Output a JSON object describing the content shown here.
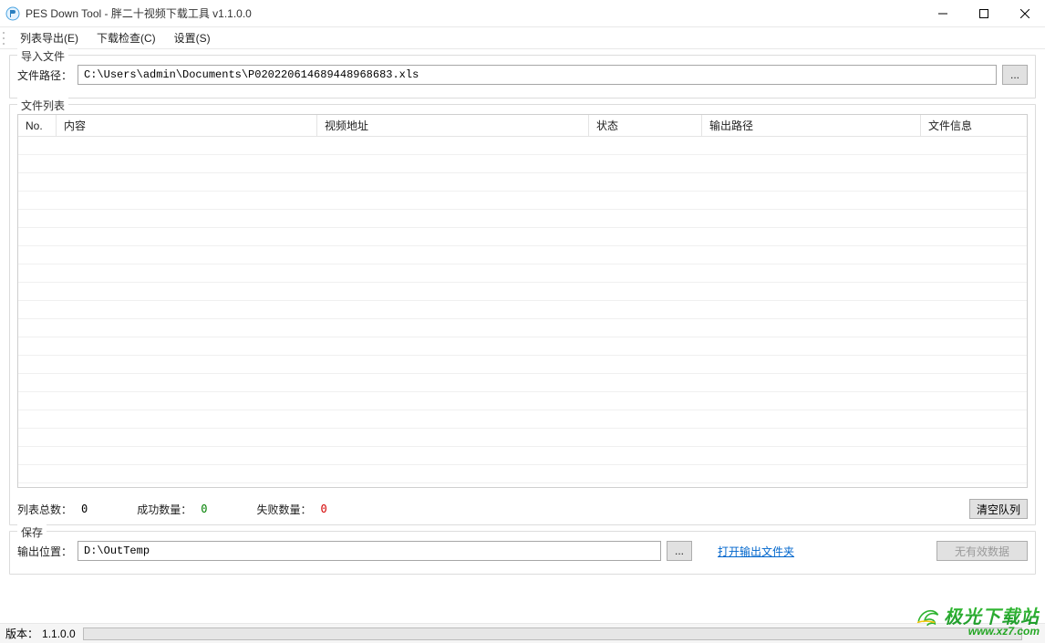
{
  "window": {
    "title": "PES Down Tool - 胖二十视频下载工具 v1.1.0.0"
  },
  "menu": {
    "export": "列表导出(E)",
    "check": "下载检查(C)",
    "settings": "设置(S)"
  },
  "import_group": {
    "title": "导入文件",
    "path_label": "文件路径：",
    "path_value": "C:\\Users\\admin\\Documents\\P020220614689448968683.xls",
    "browse_label": "..."
  },
  "filelist_group": {
    "title": "文件列表",
    "columns": {
      "no": "No.",
      "content": "内容",
      "video_url": "视频地址",
      "status": "状态",
      "output_path": "输出路径",
      "file_info": "文件信息"
    },
    "rows": []
  },
  "stats": {
    "total_label": "列表总数：",
    "total_value": "0",
    "success_label": "成功数量：",
    "success_value": "0",
    "fail_label": "失败数量：",
    "fail_value": "0",
    "clear_label": "清空队列"
  },
  "save_group": {
    "title": "保存",
    "output_label": "输出位置：",
    "output_value": "D:\\OutTemp",
    "browse_label": "...",
    "open_link": "打开输出文件夹",
    "no_data_label": "无有效数据"
  },
  "statusbar": {
    "version_label": "版本：",
    "version_value": "1.1.0.0"
  },
  "watermark": {
    "brand": "极光下载站",
    "url": "www.xz7.com"
  }
}
